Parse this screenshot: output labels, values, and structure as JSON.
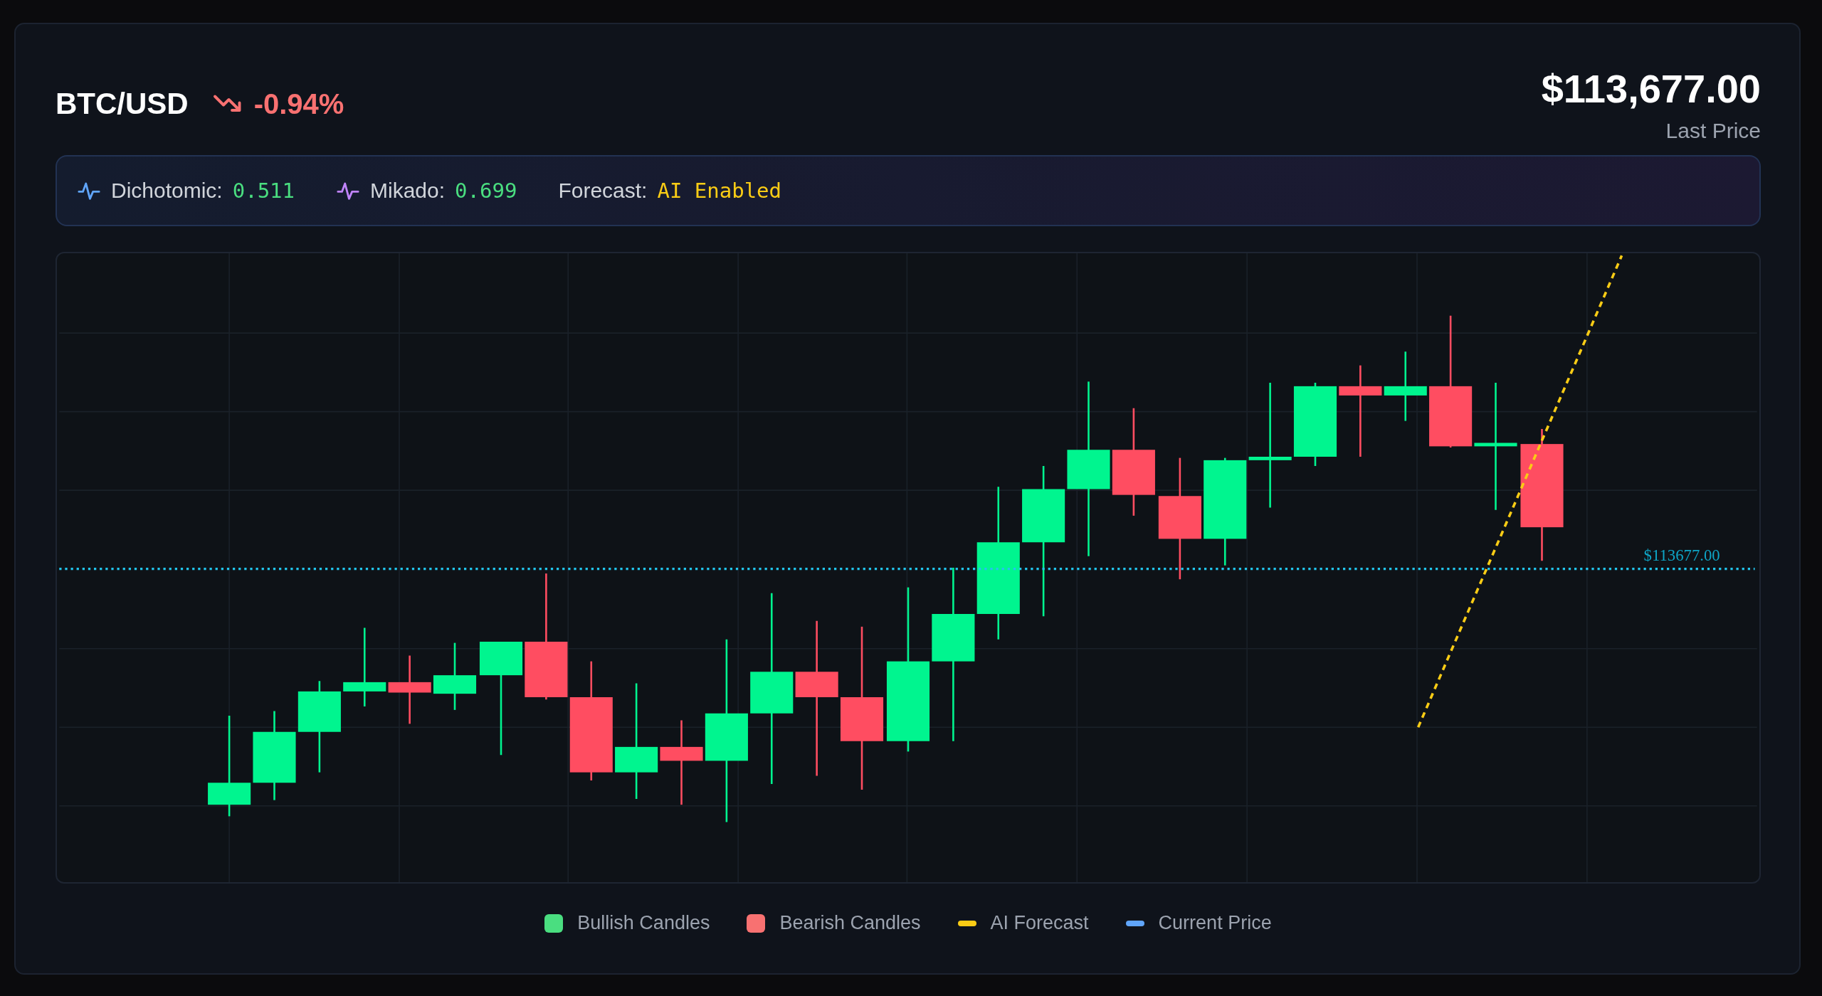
{
  "header": {
    "symbol": "BTC/USD",
    "change": {
      "text": "-0.94%",
      "falling": true
    }
  },
  "price": {
    "value": "$113,677.00",
    "label": "Last Price"
  },
  "metrics": [
    {
      "kind": "indicator",
      "label": "Dichotomic:",
      "value": "0.511",
      "color": "#60a5fa"
    },
    {
      "kind": "indicator",
      "label": "Mikado:",
      "value": "0.699",
      "color": "#c084fc"
    },
    {
      "kind": "status",
      "label": "Forecast:",
      "value": "AI Enabled"
    }
  ],
  "chart": {
    "price_label": "$113677.00"
  },
  "legend": [
    {
      "kind": "swatch",
      "label": "Bullish Candles",
      "color": "#4ade80"
    },
    {
      "kind": "swatch",
      "label": "Bearish Candles",
      "color": "#f87171"
    },
    {
      "kind": "line",
      "label": "AI Forecast",
      "color": "#facc15"
    },
    {
      "kind": "line",
      "label": "Current Price",
      "color": "#60a5fa"
    }
  ]
}
